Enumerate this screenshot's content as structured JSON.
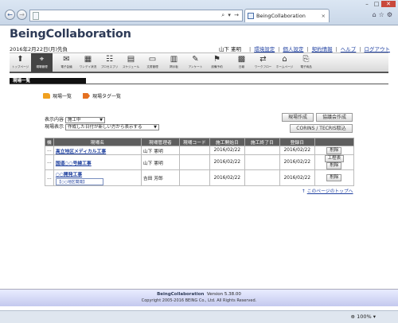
{
  "browser": {
    "address_controls": "⌕ ▾ →",
    "tab_title": "BeingCollaboration",
    "tab_close": "×",
    "window_controls": {
      "minimize": "–",
      "maximize": "□",
      "close": "✕"
    },
    "toolbar_icons": "⌂☆⚙",
    "back_icon": "←",
    "forward_icon": "→",
    "zoom": "100%"
  },
  "header": {
    "brand": "BeingCollaboration",
    "date": "2016年2月22日(月)先負",
    "user_name": "山下 憲明",
    "links": [
      "環境設定",
      "個人設定",
      "契約情報",
      "ヘルプ",
      "ログアウト"
    ]
  },
  "menu": [
    {
      "label": "トップページ",
      "icon": "⬆",
      "active": false
    },
    {
      "label": "現場管理",
      "icon": "⌖",
      "active": true
    },
    {
      "label": "電子会議",
      "icon": "✉",
      "active": false
    },
    {
      "label": "ワンデイ状況",
      "icon": "▦",
      "active": false
    },
    {
      "label": "プロセスプリ",
      "icon": "☷",
      "active": false
    },
    {
      "label": "スケジュール",
      "icon": "▤",
      "active": false
    },
    {
      "label": "文書管理",
      "icon": "▭",
      "active": false
    },
    {
      "label": "掲示板",
      "icon": "▥",
      "active": false
    },
    {
      "label": "アンケート",
      "icon": "✎",
      "active": false
    },
    {
      "label": "設備予約",
      "icon": "⚑",
      "active": false
    },
    {
      "label": "日報",
      "icon": "▩",
      "active": false
    },
    {
      "label": "ワークフロー",
      "icon": "⇄",
      "active": false
    },
    {
      "label": "ホームページ",
      "icon": "⌂",
      "active": false
    },
    {
      "label": "電子納品",
      "icon": "⎘",
      "active": false
    }
  ],
  "page": {
    "heading": "現場一覧",
    "link_list": "現場一覧",
    "link_tags": "現場タグ一覧",
    "filter_status_label": "表示内容",
    "filter_status_value": "施工中",
    "filter_order_label": "現場表示",
    "filter_order_value": "作成した日付が新しい方から表示する",
    "btn_create": "現場作成",
    "btn_council": "協議会作成",
    "btn_corins": "CORINS / TECRIS取込",
    "back_to_top": "このページのトップへ"
  },
  "table": {
    "headers": [
      "機",
      "現場名",
      "現場管理者",
      "現場コード",
      "施工開始日",
      "施工終了日",
      "登録日",
      ""
    ],
    "rows": [
      {
        "mark": "…",
        "name": "高立地区メディカル工事",
        "sub": "",
        "manager": "山下 憲明",
        "code": "",
        "start": "2016/02/22",
        "end": "",
        "registered": "2016/02/22",
        "actions": [
          "削除"
        ]
      },
      {
        "mark": "…",
        "name": "国道○○号線工事",
        "sub": "",
        "manager": "山下 憲明",
        "code": "",
        "start": "2016/02/22",
        "end": "",
        "registered": "2016/02/22",
        "actions": [
          "工程表",
          "削除"
        ]
      },
      {
        "mark": "…",
        "name": "○○開発工事",
        "sub": "【○○地区開発】",
        "manager": "吉田 芳郎",
        "code": "",
        "start": "2016/02/22",
        "end": "",
        "registered": "2016/02/22",
        "actions": [
          "削除"
        ]
      }
    ]
  },
  "footer": {
    "brand": "BeingCollaboration",
    "version": "Version 5.38.00",
    "copyright": "Copyright 2005-2016 BEING Co., Ltd. All Rights Reserved."
  }
}
